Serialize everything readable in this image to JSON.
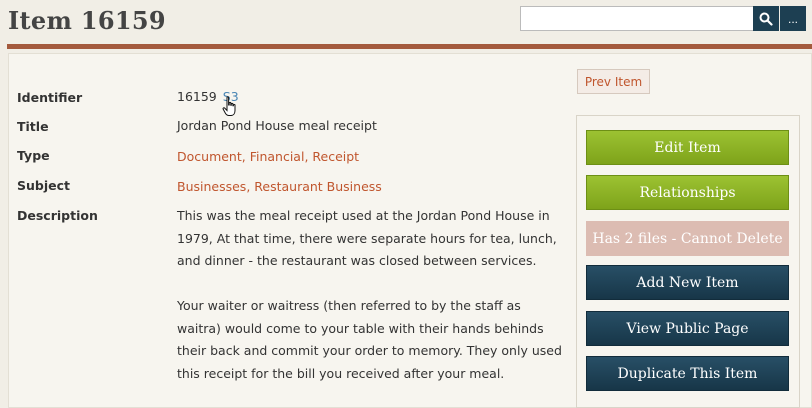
{
  "header": {
    "title": "Item 16159",
    "search": {
      "value": "",
      "placeholder": ""
    },
    "more_label": "..."
  },
  "fields": {
    "identifier": {
      "label": "Identifier",
      "value": "16159",
      "link": "S3"
    },
    "title": {
      "label": "Title",
      "value": "Jordan Pond House meal receipt"
    },
    "type": {
      "label": "Type",
      "value": "Document, Financial, Receipt"
    },
    "subject": {
      "label": "Subject",
      "value": "Businesses, Restaurant Business"
    },
    "description": {
      "label": "Description",
      "paragraphs": [
        "This was the meal receipt used at the Jordan Pond House in 1979, At that time, there were separate hours for tea, lunch, and dinner - the restaurant was closed between services.",
        "Your waiter or waitress (then referred to by the staff as waitra) would come to your table with their hands behinds their back and commit your order to memory. They only used this receipt for the bill you received after your meal."
      ]
    }
  },
  "nav": {
    "prev_label": "Prev Item"
  },
  "actions": {
    "edit": "Edit Item",
    "relationships": "Relationships",
    "delete_disabled": "Has 2 files - Cannot Delete",
    "add_new": "Add New Item",
    "view_public": "View Public Page",
    "duplicate": "Duplicate This Item"
  },
  "colors": {
    "accent_rule": "#a45a3d",
    "link": "#c0562e",
    "green_button": "#8cb425",
    "dark_button": "#1d3f52",
    "disabled_button": "#dcbcb2"
  }
}
